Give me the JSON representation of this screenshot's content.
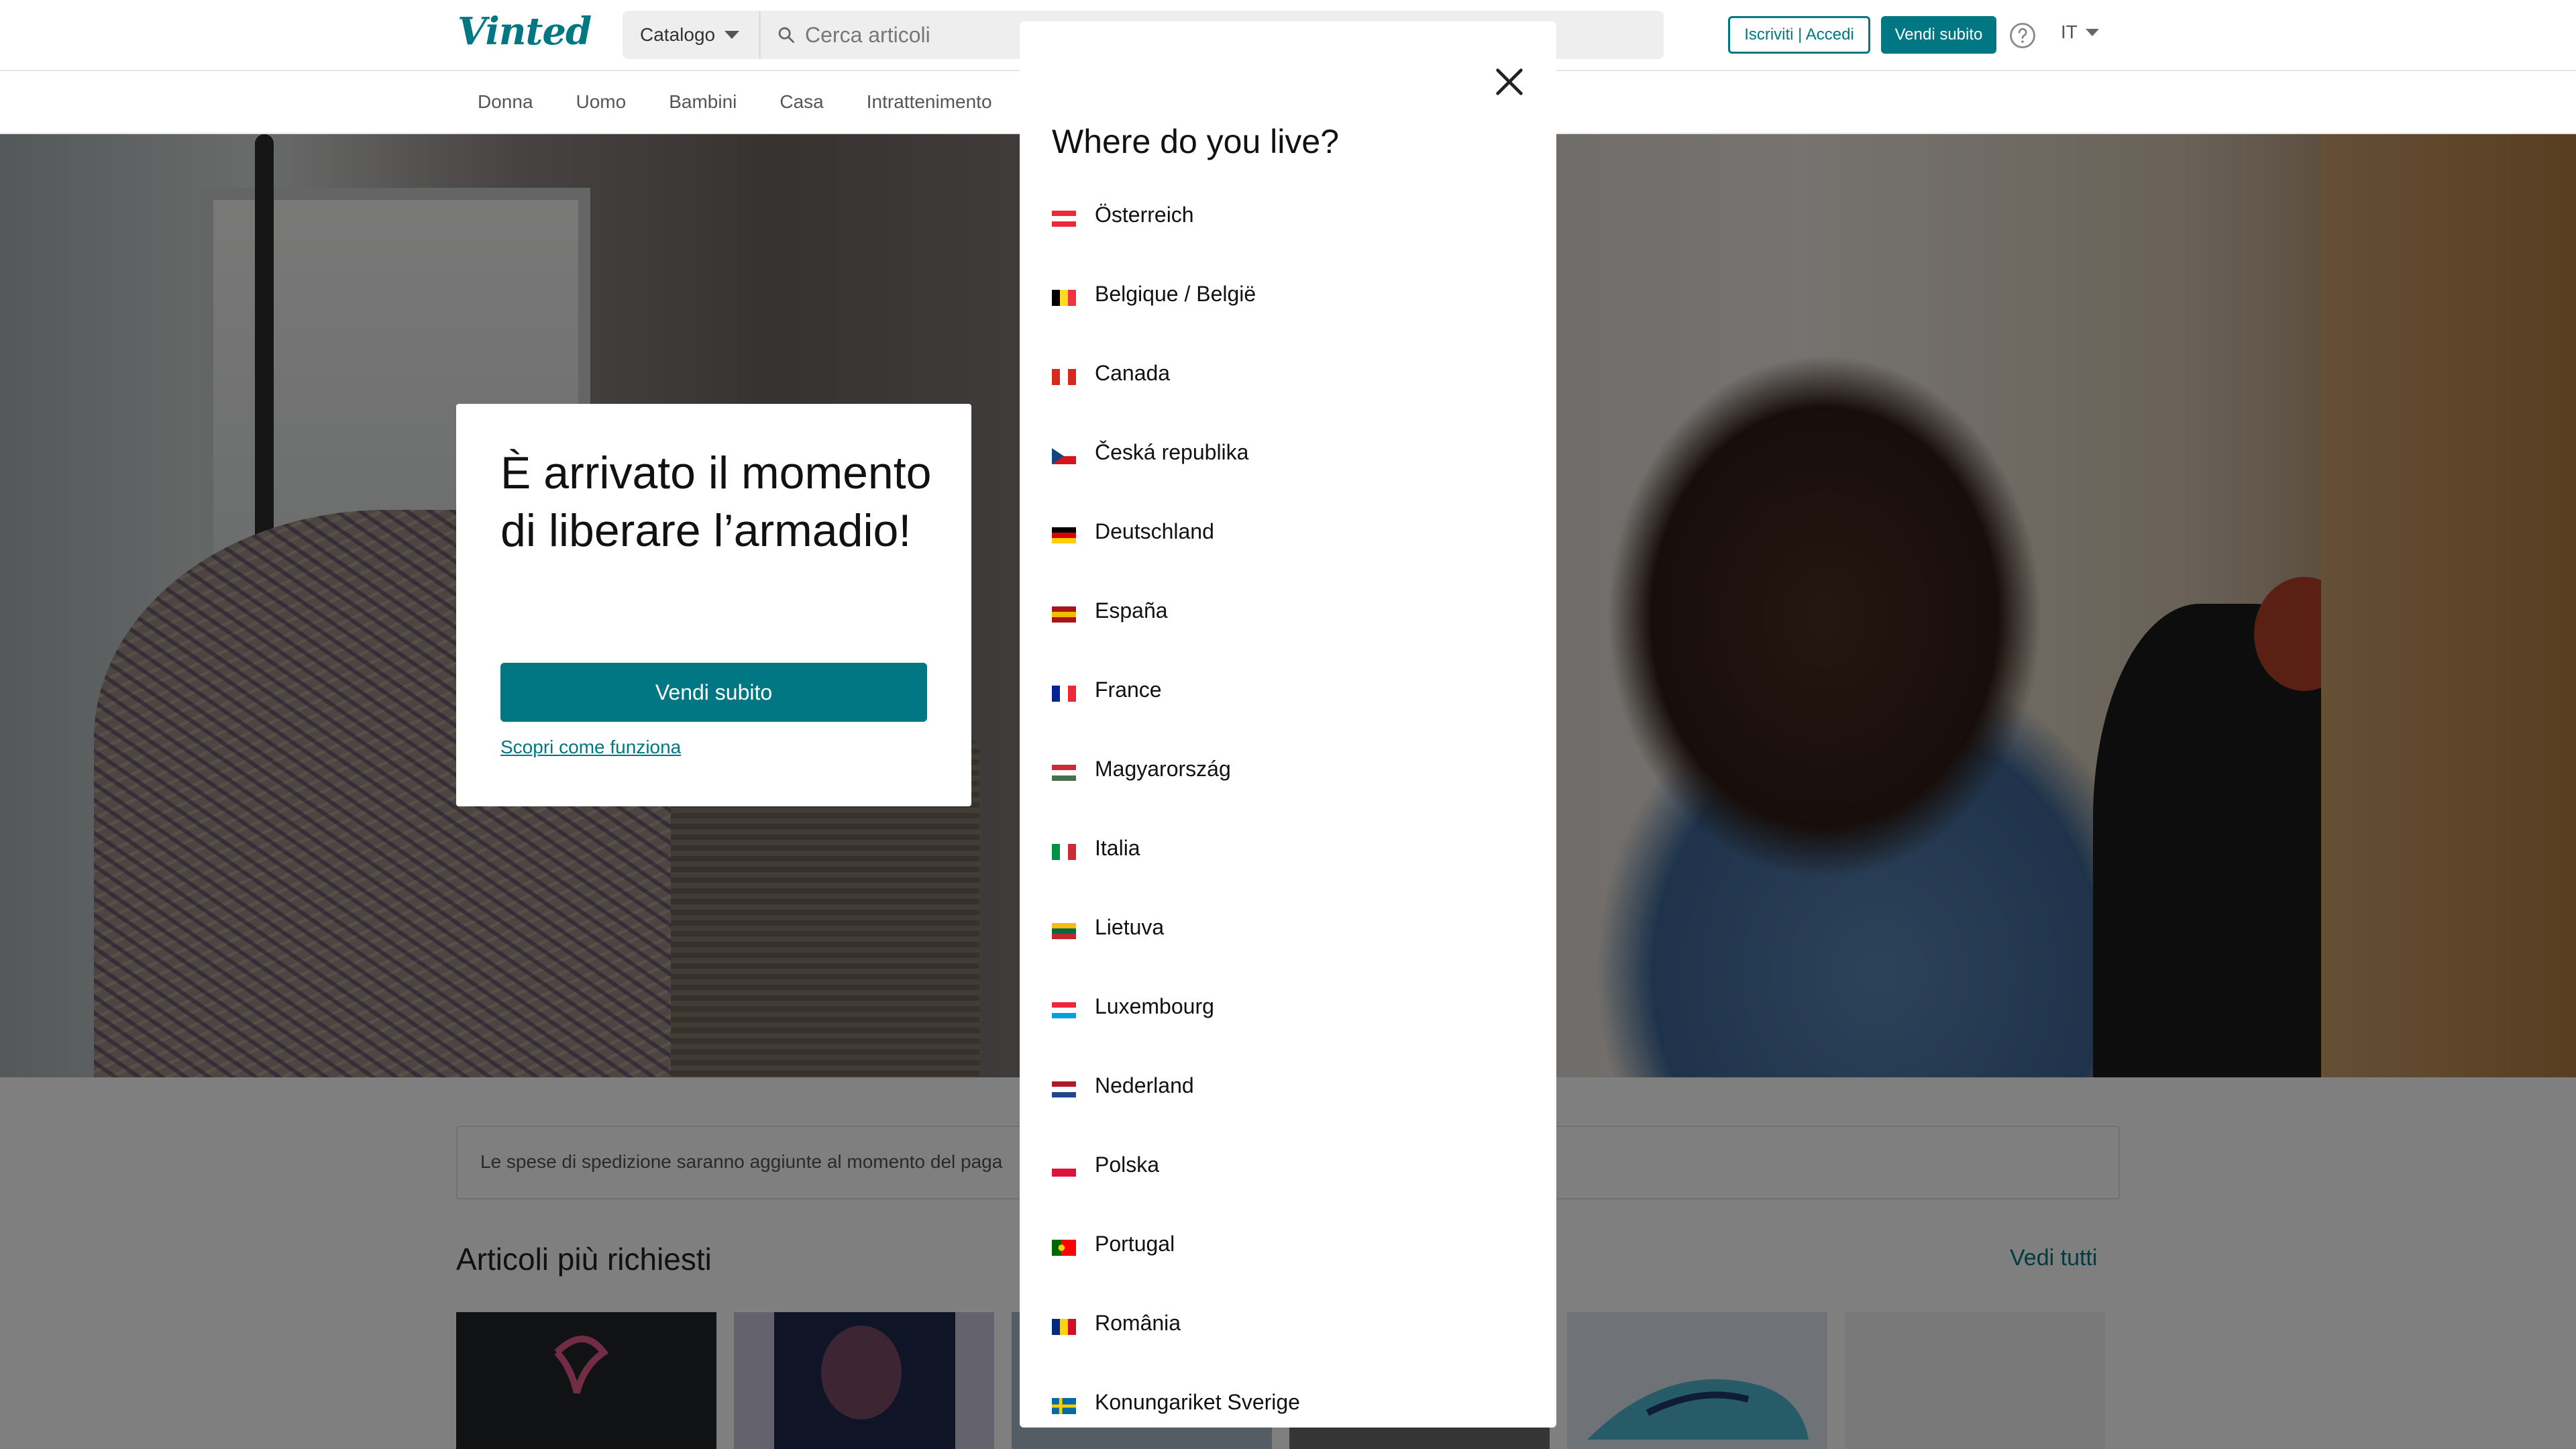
{
  "header": {
    "logo": "Vinted",
    "catalog_label": "Catalogo",
    "search_placeholder": "Cerca articoli",
    "signup_login_label": "Iscriviti | Accedi",
    "sell_label": "Vendi subito",
    "language": "IT"
  },
  "categories": [
    "Donna",
    "Uomo",
    "Bambini",
    "Casa",
    "Intrattenimento"
  ],
  "hero": {
    "title": "È arrivato il momento di liberare l’armadio!",
    "button": "Vendi subito",
    "link": "Scopri come funziona"
  },
  "shipping_notice": "Le spese di spedizione saranno aggiunte al momento del paga",
  "popular": {
    "title": "Articoli più richiesti",
    "see_all": "Vedi tutti"
  },
  "modal": {
    "title": "Where do you live?",
    "countries": [
      {
        "name": "Österreich",
        "flag_colors": [
          "#ed2939",
          "#ffffff",
          "#ed2939"
        ],
        "flag_direction": "horizontal"
      },
      {
        "name": "Belgique / België",
        "flag_colors": [
          "#000000",
          "#fdda24",
          "#ef3340"
        ],
        "flag_direction": "vertical"
      },
      {
        "name": "Canada",
        "flag_colors": [
          "#d52b1e",
          "#ffffff",
          "#d52b1e"
        ],
        "flag_direction": "vertical"
      },
      {
        "name": "Česká republika",
        "flag_colors": [
          "#ffffff",
          "#d7141a",
          "#11457e"
        ],
        "flag_direction": "czech"
      },
      {
        "name": "Deutschland",
        "flag_colors": [
          "#000000",
          "#dd0000",
          "#ffce00"
        ],
        "flag_direction": "horizontal"
      },
      {
        "name": "España",
        "flag_colors": [
          "#aa151b",
          "#f1bf00",
          "#aa151b"
        ],
        "flag_direction": "horizontal"
      },
      {
        "name": "France",
        "flag_colors": [
          "#002395",
          "#ffffff",
          "#ed2939"
        ],
        "flag_direction": "vertical"
      },
      {
        "name": "Magyarország",
        "flag_colors": [
          "#ce2939",
          "#ffffff",
          "#477050"
        ],
        "flag_direction": "horizontal"
      },
      {
        "name": "Italia",
        "flag_colors": [
          "#009246",
          "#ffffff",
          "#ce2b37"
        ],
        "flag_direction": "vertical"
      },
      {
        "name": "Lietuva",
        "flag_colors": [
          "#fdb913",
          "#006a44",
          "#c1272d"
        ],
        "flag_direction": "horizontal"
      },
      {
        "name": "Luxembourg",
        "flag_colors": [
          "#ed2939",
          "#ffffff",
          "#00a1de"
        ],
        "flag_direction": "horizontal"
      },
      {
        "name": "Nederland",
        "flag_colors": [
          "#ae1c28",
          "#ffffff",
          "#21468b"
        ],
        "flag_direction": "horizontal"
      },
      {
        "name": "Polska",
        "flag_colors": [
          "#ffffff",
          "#dc143c"
        ],
        "flag_direction": "horizontal"
      },
      {
        "name": "Portugal",
        "flag_colors": [
          "#006600",
          "#ff0000"
        ],
        "flag_direction": "portugal"
      },
      {
        "name": "România",
        "flag_colors": [
          "#002b7f",
          "#fcd116",
          "#ce1126"
        ],
        "flag_direction": "vertical"
      },
      {
        "name": "Konungariket Sverige",
        "flag_colors": [
          "#006aa7",
          "#fecc00"
        ],
        "flag_direction": "sweden"
      }
    ]
  },
  "colors": {
    "brand": "#007782",
    "overlay": "rgba(0,0,0,0.5)"
  }
}
